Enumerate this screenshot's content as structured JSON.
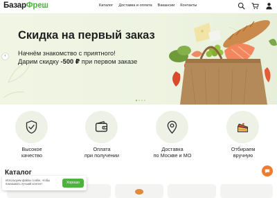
{
  "header": {
    "logo_part1": "Базар",
    "logo_part2": "Фреш",
    "nav": [
      "Каталог",
      "Доставка и оплата",
      "Вакансии",
      "Контакты"
    ],
    "icons": [
      "search-icon",
      "cart-icon",
      "user-icon"
    ]
  },
  "banner": {
    "title": "Скидка на первый заказ",
    "line1": "Начнём знакомство с приятного!",
    "line2_prefix": "Дарим скидку ",
    "line2_amount": "-500 ₽",
    "line2_suffix": " при первом заказе"
  },
  "features": [
    {
      "line1": "Высокое",
      "line2": "качество",
      "icon": "shield-check-icon"
    },
    {
      "line1": "Оплата",
      "line2": "при получении",
      "icon": "wallet-icon"
    },
    {
      "line1": "Доставка",
      "line2": "по Москве и МО",
      "icon": "map-pin-icon"
    },
    {
      "line1": "Отбираем",
      "line2": "вручную",
      "icon": "cake-icon"
    }
  ],
  "catalog": {
    "title": "Каталог"
  },
  "cookie": {
    "text": "Используем файлы cookie, чтобы показывать лучший контент",
    "button": "Хорошо"
  },
  "colors": {
    "brand_green": "#4cb33c",
    "chat_orange": "#f07b2e",
    "feature_bg": "#eef2e6"
  }
}
